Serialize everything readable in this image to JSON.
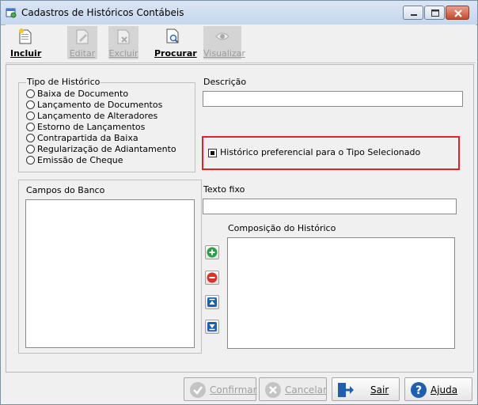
{
  "window": {
    "title": "Cadastros de Históricos Contábeis"
  },
  "toolbar": {
    "incluir": "Incluir",
    "editar": "Editar",
    "excluir": "Excluir",
    "procurar": "Procurar",
    "visualizar": "Visualizar"
  },
  "tipo": {
    "label": "Tipo de Histórico",
    "options": [
      "Baixa de Documento",
      "Lançamento de Documentos",
      "Lançamento de Alteradores",
      "Estorno de Lançamentos",
      "Contrapartida da Baixa",
      "Regularização de Adiantamento",
      "Emissão de Cheque"
    ]
  },
  "descricao": {
    "label": "Descrição",
    "value": ""
  },
  "preferencial": {
    "label": "Histórico preferencial para o Tipo Selecionado",
    "checked": true
  },
  "campos": {
    "label": "Campos do Banco"
  },
  "texto_fixo": {
    "label": "Texto fixo",
    "value": ""
  },
  "composicao": {
    "label": "Composição do Histórico"
  },
  "footer": {
    "confirmar": "Confirmar",
    "cancelar": "Cancelar",
    "sair": "Sair",
    "ajuda": "Ajuda"
  },
  "colors": {
    "highlight": "#e41e2a",
    "close": "#c44a2b"
  }
}
